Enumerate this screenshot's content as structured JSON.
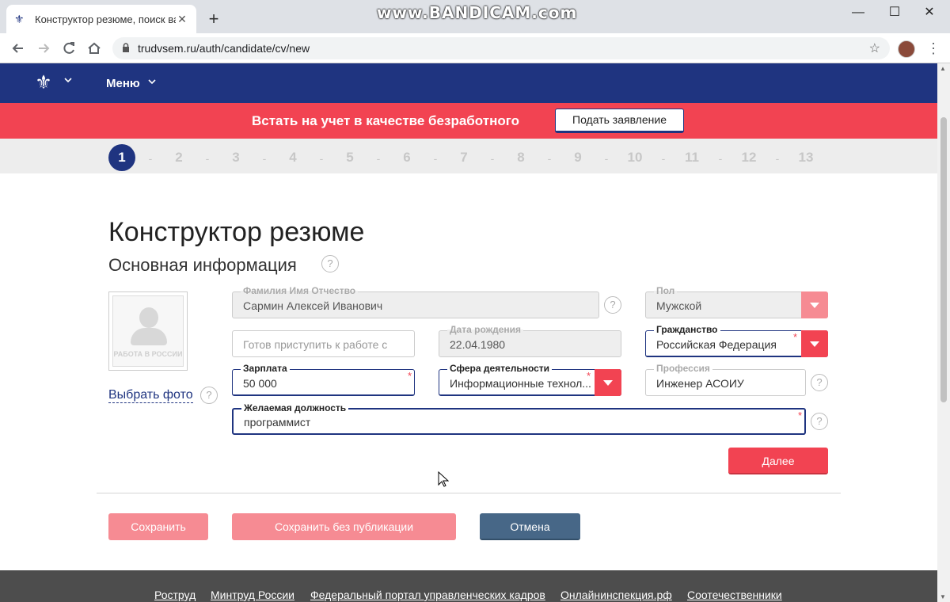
{
  "browser": {
    "tab_title": "Конструктор резюме, поиск вак",
    "tab_close": "✕",
    "new_tab": "+",
    "url": "trudvsem.ru/auth/candidate/cv/new",
    "watermark": "www.BANDICAM.com",
    "minimize": "—",
    "maximize": "☐",
    "close": "✕"
  },
  "site_header": {
    "menu_label": "Меню"
  },
  "banner": {
    "text": "Встать на учет в качестве безработного",
    "button_label": "Подать заявление"
  },
  "steps": {
    "items": [
      "1",
      "2",
      "3",
      "4",
      "5",
      "6",
      "7",
      "8",
      "9",
      "10",
      "11",
      "12",
      "13"
    ],
    "active_index": 0,
    "separator": "-"
  },
  "page": {
    "title": "Конструктор резюме",
    "section_title": "Основная информация",
    "help_glyph": "?",
    "photo_caption": "РАБОТА В РОССИИ",
    "choose_photo": "Выбрать фото"
  },
  "form": {
    "fio": {
      "label": "Фамилия Имя Отчество",
      "value": "Сармин Алексей Иванович"
    },
    "gender": {
      "label": "Пол",
      "value": "Мужской"
    },
    "ready_from": {
      "placeholder": "Готов приступить к работе с"
    },
    "birth_date": {
      "label": "Дата рождения",
      "value": "22.04.1980"
    },
    "citizenship": {
      "label": "Гражданство",
      "value": "Российская Федерация"
    },
    "salary": {
      "label": "Зарплата",
      "value": "50 000"
    },
    "sphere": {
      "label": "Сфера деятельности",
      "value": "Информационные технол..."
    },
    "profession": {
      "label": "Профессия",
      "value": "Инженер АСОИУ"
    },
    "position": {
      "label": "Желаемая должность",
      "value": "программист"
    },
    "required_mark": "*"
  },
  "actions": {
    "next": "Далее",
    "save": "Сохранить",
    "save_unpublished": "Сохранить без публикации",
    "cancel": "Отмена"
  },
  "footer": {
    "links": [
      "Роструд",
      "Минтруд России",
      "Федеральный портал управленческих кадров",
      "Онлайнинспекция.рф",
      "Соотечественники"
    ]
  },
  "colors": {
    "brand_blue": "#1f3480",
    "accent_red": "#f24352",
    "button_pink": "#f68b93",
    "button_slate": "#476787"
  }
}
